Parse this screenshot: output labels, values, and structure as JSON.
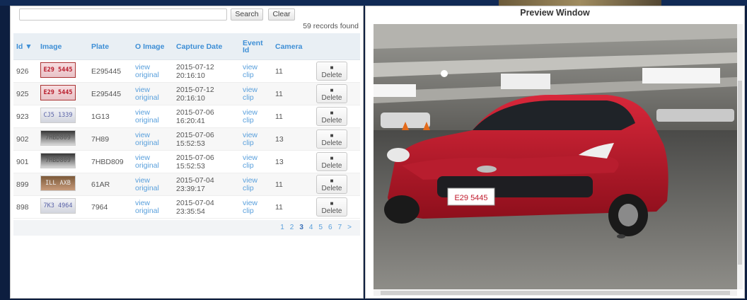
{
  "search": {
    "placeholder": "",
    "search_label": "Search",
    "clear_label": "Clear"
  },
  "records_text": "59 records found",
  "columns": [
    "Id ▼",
    "Image",
    "Plate",
    "O Image",
    "Capture Date",
    "Event Id",
    "Camera",
    ""
  ],
  "rows": [
    {
      "id": "926",
      "plate_img": "E29 5445",
      "plate": "E295445",
      "oimg1": "view",
      "oimg2": "original",
      "date": "2015-07-12",
      "time": "20:16:10",
      "ev1": "view",
      "ev2": "clip",
      "camera": "11",
      "del": "Delete"
    },
    {
      "id": "925",
      "plate_img": "E29 5445",
      "plate": "E295445",
      "oimg1": "view",
      "oimg2": "original",
      "date": "2015-07-12",
      "time": "20:16:10",
      "ev1": "view",
      "ev2": "clip",
      "camera": "11",
      "del": "Delete"
    },
    {
      "id": "923",
      "plate_img": "CJ5 1339",
      "plate": "1G13",
      "oimg1": "view",
      "oimg2": "original",
      "date": "2015-07-06",
      "time": "16:20:41",
      "ev1": "view",
      "ev2": "clip",
      "camera": "11",
      "del": "Delete"
    },
    {
      "id": "902",
      "plate_img": "7HBD809",
      "plate": "7H89",
      "oimg1": "view",
      "oimg2": "original",
      "date": "2015-07-06",
      "time": "15:52:53",
      "ev1": "view",
      "ev2": "clip",
      "camera": "13",
      "del": "Delete"
    },
    {
      "id": "901",
      "plate_img": "7HBD809",
      "plate": "7HBD809",
      "oimg1": "view",
      "oimg2": "original",
      "date": "2015-07-06",
      "time": "15:52:53",
      "ev1": "view",
      "ev2": "clip",
      "camera": "13",
      "del": "Delete"
    },
    {
      "id": "899",
      "plate_img": "ILL AXB",
      "plate": "61AR",
      "oimg1": "view",
      "oimg2": "original",
      "date": "2015-07-04",
      "time": "23:39:17",
      "ev1": "view",
      "ev2": "clip",
      "camera": "11",
      "del": "Delete"
    },
    {
      "id": "898",
      "plate_img": "7K3 4964",
      "plate": "7964",
      "oimg1": "view",
      "oimg2": "original",
      "date": "2015-07-04",
      "time": "23:35:54",
      "ev1": "view",
      "ev2": "clip",
      "camera": "11",
      "del": "Delete"
    }
  ],
  "pagination": {
    "pages": [
      "1",
      "2",
      "3",
      "4",
      "5",
      "6",
      "7"
    ],
    "current": "3",
    "next": ">"
  },
  "preview": {
    "title": "Preview Window",
    "plate_text": "E29 5445"
  },
  "icons": {
    "delete": "trash-icon"
  },
  "colors": {
    "link": "#5aa0dc",
    "header_text": "#3e8fd6",
    "car": "#c0172a",
    "background": "#0d1e3f"
  }
}
